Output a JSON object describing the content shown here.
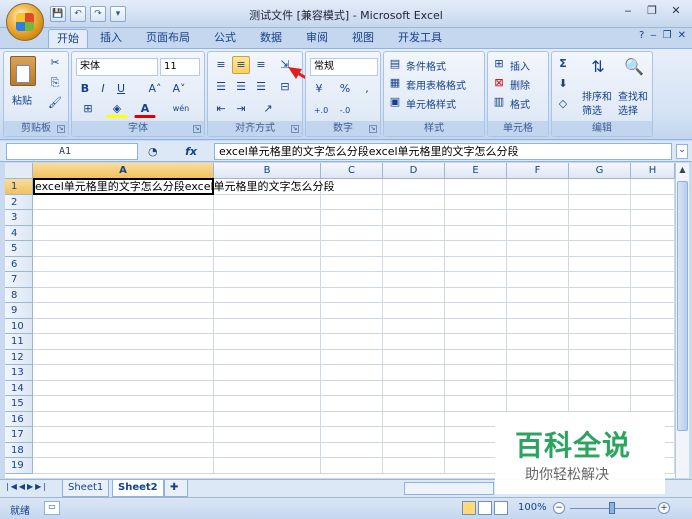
{
  "window": {
    "title": "测试文件 [兼容模式] - Microsoft Excel",
    "minimize": "‒",
    "restore": "❐",
    "close": "✕"
  },
  "qat": {
    "save": "💾",
    "undo": "↶",
    "redo": "↷",
    "more": "▾"
  },
  "tabs": [
    {
      "label": "开始",
      "active": true
    },
    {
      "label": "插入"
    },
    {
      "label": "页面布局"
    },
    {
      "label": "公式"
    },
    {
      "label": "数据"
    },
    {
      "label": "审阅"
    },
    {
      "label": "视图"
    },
    {
      "label": "开发工具"
    }
  ],
  "help_ctrls": [
    "?",
    "‒",
    "❐",
    "✕"
  ],
  "ribbon": {
    "clipboard": {
      "label": "剪贴板",
      "paste": "粘贴"
    },
    "font": {
      "label": "字体",
      "name": "宋体",
      "size": "11",
      "bold": "B",
      "italic": "I",
      "underline": "U",
      "grow": "A˄",
      "shrink": "A˅",
      "font_color": "A",
      "pinyin": "wén"
    },
    "alignment": {
      "label": "对齐方式"
    },
    "number": {
      "label": "数字",
      "format": "常规",
      "percent": "%",
      "comma": ",",
      "inc_decimal": "+.0",
      "dec_decimal": "-.0",
      "currency": "¥"
    },
    "styles": {
      "label": "样式",
      "cond_format": "条件格式",
      "table_format": "套用表格格式",
      "cell_style": "单元格样式"
    },
    "cells": {
      "label": "单元格",
      "insert": "插入",
      "delete": "删除",
      "format": "格式"
    },
    "editing": {
      "label": "编辑",
      "sigma": "Σ",
      "sort": "排序和",
      "filter": "筛选",
      "find": "查找和",
      "select": "选择"
    }
  },
  "formula_bar": {
    "name_box": "A1",
    "fx": "fx",
    "formula": "excel单元格里的文字怎么分段excel单元格里的文字怎么分段"
  },
  "columns": [
    "A",
    "B",
    "C",
    "D",
    "E",
    "F",
    "G",
    "H"
  ],
  "rows": [
    "1",
    "2",
    "3",
    "4",
    "5",
    "6",
    "7",
    "8",
    "9",
    "10",
    "11",
    "12",
    "13",
    "14",
    "15",
    "16",
    "17",
    "18",
    "19"
  ],
  "cell_a1": "excel单元格里的文字怎么分段excel单元格里的文字怎么分段",
  "sheets": [
    "Sheet1",
    "Sheet2"
  ],
  "status": {
    "ready": "就绪",
    "zoom": "100%"
  },
  "watermark": {
    "line1": "百科全说",
    "line2": "助你轻松解决"
  },
  "colors": {
    "accent": "#15428b",
    "watermark_green": "#2aa45f",
    "arrow_red": "#e02020"
  }
}
